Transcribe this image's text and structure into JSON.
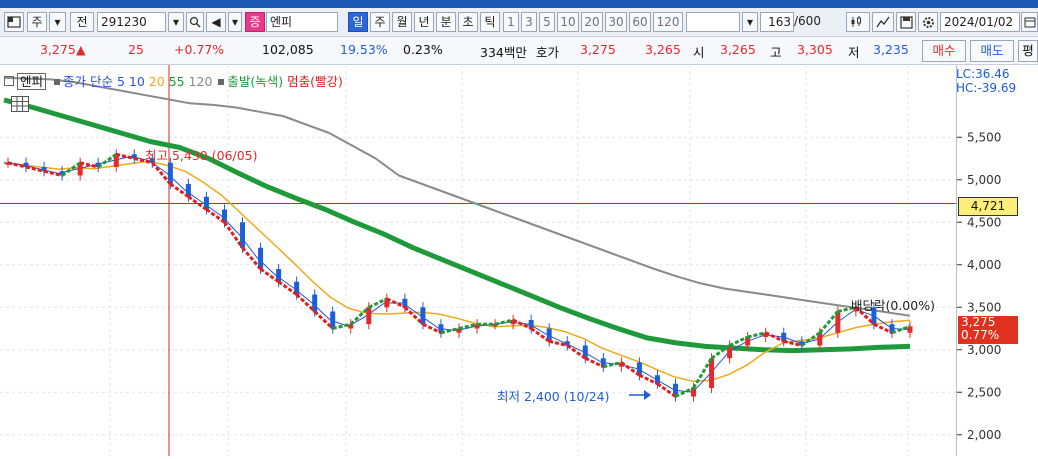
{
  "toolbar": {
    "market_btn": "주",
    "market_dropdown": "▾",
    "prefix_label": "전",
    "code_value": "291230",
    "search_dropdown": "▾",
    "search_icon": "🔍",
    "sound_icon": "◀",
    "sound_dropdown": "▾",
    "badge_label": "증",
    "stock_name": "엔피",
    "period_tabs": [
      "일",
      "주",
      "월",
      "년",
      "분",
      "초",
      "틱"
    ],
    "interval_tabs": [
      "1",
      "3",
      "5",
      "10",
      "20",
      "30",
      "60",
      "120"
    ],
    "interval_dropdown": "▾",
    "count_value": "163",
    "count_total": "/600",
    "date_value": "2024/01/02"
  },
  "ticker": {
    "price": "3,275",
    "change_arrow": "▲",
    "change": "25",
    "change_pct": "+0.77%",
    "volume": "102,085",
    "turnover_pct": "19.53%",
    "ratio_pct": "0.23%",
    "amount": "334백만",
    "ask_label": "호가",
    "ask_value": "3,275",
    "bid_value": "3,265",
    "open_label": "시",
    "open_value": "3,265",
    "high_label": "고",
    "high_value": "3,305",
    "low_label": "저",
    "low_value": "3,235",
    "buy_button": "매수",
    "sell_button": "매도",
    "extra_button": "평"
  },
  "legend": {
    "name": "엔피",
    "ma_label": "종가 단순",
    "ma5": "5",
    "ma10": "10",
    "ma20": "20",
    "ma55": "55",
    "ma120": "120",
    "start_label": "출발(녹색)",
    "stop_label": "멈춤(빨강)"
  },
  "axis": {
    "lc": "LC:36.46",
    "hc": "HC:-39.69",
    "current_price_box": "4,721",
    "last_price": "3,275",
    "last_pct": "0.77%"
  },
  "annotations": {
    "high": "최고 5,430 (06/05)",
    "low": "최저 2,400 (10/24)",
    "dividend": "배당락(0.00%)"
  },
  "colors": {
    "up": "#e22b2b",
    "down": "#1f5fd6",
    "ma5": "#2c4fd8",
    "ma10": "#2c4fd8",
    "ma20": "#f0a91c",
    "ma55": "#1e9a3a",
    "ma120": "#8a8a8a",
    "start_signal": "#1f9a3a",
    "stop_signal": "#e02020"
  },
  "chart_data": {
    "type": "line",
    "ylim": [
      1750,
      6350
    ],
    "y_ticks": [
      5500,
      5000,
      4500,
      4000,
      3500,
      3000,
      2500,
      2000
    ],
    "y_tick_labels": [
      "5,500",
      "5,000",
      "4,500",
      "4,000",
      "3,500",
      "3,000",
      "2,500",
      "2,000"
    ],
    "horizontal_line": 4721,
    "series": [
      {
        "name": "종가",
        "values": [
          5200,
          5150,
          5100,
          5050,
          5200,
          5150,
          5300,
          5250,
          5200,
          4950,
          4800,
          4650,
          4500,
          4200,
          3950,
          3800,
          3650,
          3450,
          3250,
          3300,
          3500,
          3600,
          3500,
          3300,
          3200,
          3250,
          3300,
          3300,
          3350,
          3250,
          3100,
          3050,
          2900,
          2800,
          2850,
          2700,
          2600,
          2450,
          2550,
          2900,
          3050,
          3150,
          3200,
          3100,
          3050,
          3200,
          3450,
          3500,
          3300,
          3200,
          3275
        ]
      },
      {
        "name": "120",
        "values": [
          6200,
          6190,
          6180,
          6150,
          6100,
          6050,
          6000,
          5950,
          5900,
          5880,
          5850,
          5800,
          5750,
          5650,
          5550,
          5400,
          5250,
          5050,
          4950,
          4850,
          4750,
          4650,
          4550,
          4450,
          4350,
          4250,
          4150,
          4050,
          3950,
          3860,
          3780,
          3720,
          3680,
          3640,
          3600,
          3560,
          3520,
          3480,
          3440,
          3400
        ]
      },
      {
        "name": "55",
        "values": [
          5940,
          5850,
          5750,
          5650,
          5550,
          5450,
          5380,
          5250,
          5080,
          4920,
          4780,
          4650,
          4500,
          4360,
          4200,
          4060,
          3920,
          3780,
          3640,
          3500,
          3370,
          3250,
          3140,
          3080,
          3040,
          3020,
          3000,
          2990,
          3000,
          3010,
          3030,
          3040
        ]
      }
    ]
  }
}
